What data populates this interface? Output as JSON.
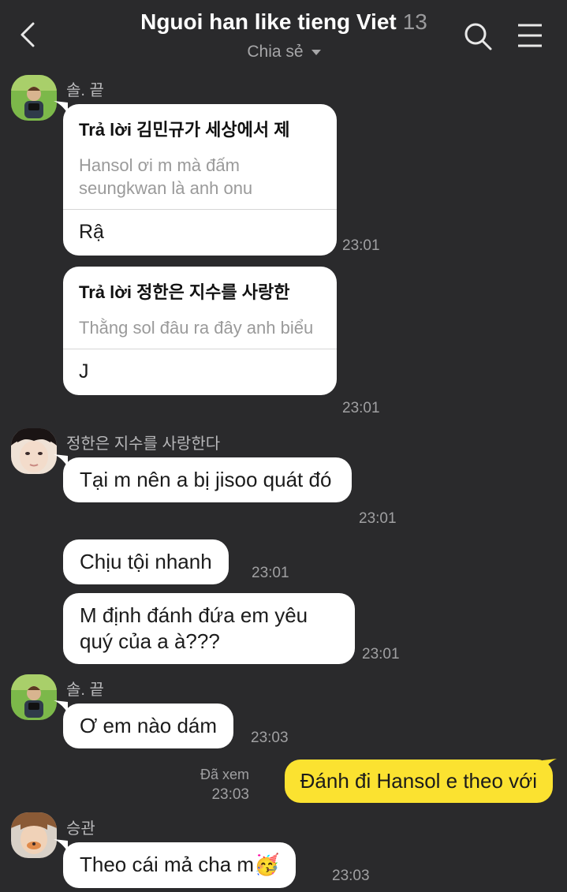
{
  "header": {
    "title": "Nguoi han like tieng Viet",
    "member_count": "13",
    "subtitle": "Chia sẻ",
    "back_icon": "chevron-left-icon",
    "search_icon": "search-icon",
    "menu_icon": "hamburger-menu-icon"
  },
  "colors": {
    "background": "#2a2a2c",
    "bubble_incoming": "#ffffff",
    "bubble_outgoing": "#fbe230",
    "meta_text": "#a0a0a2"
  },
  "messages": {
    "g1": {
      "sender": "솔. 끝",
      "reply1": {
        "reply_to": "Trả lời 김민규가 세상에서 제",
        "quote": "Hansol ơi m mà đấm seungkwan là anh onu",
        "text": "Rậ",
        "time": "23:01"
      },
      "reply2": {
        "reply_to": "Trả lời 정한은 지수를 사랑한",
        "quote": "Thằng sol đâu ra đây anh biểu",
        "text": "J",
        "time": "23:01"
      }
    },
    "g2": {
      "sender": "정한은 지수를 사랑한다",
      "m1": {
        "text": "Tại m nên a bị jisoo quát đó",
        "time": "23:01"
      },
      "m2": {
        "text": "Chịu tội nhanh",
        "time": "23:01"
      },
      "m3": {
        "text": "M định đánh đứa em yêu quý của a à???",
        "time": "23:01"
      }
    },
    "g3": {
      "sender": "솔. 끝",
      "m1": {
        "text": "Ơ em nào dám",
        "time": "23:03"
      }
    },
    "mine": {
      "seen": "Đã xem",
      "time": "23:03",
      "text": "Đánh đi Hansol e theo với"
    },
    "g4": {
      "sender": "승관",
      "m1": {
        "text": "Theo cái mả cha m",
        "emoji": "🥳",
        "time": "23:03"
      }
    }
  }
}
